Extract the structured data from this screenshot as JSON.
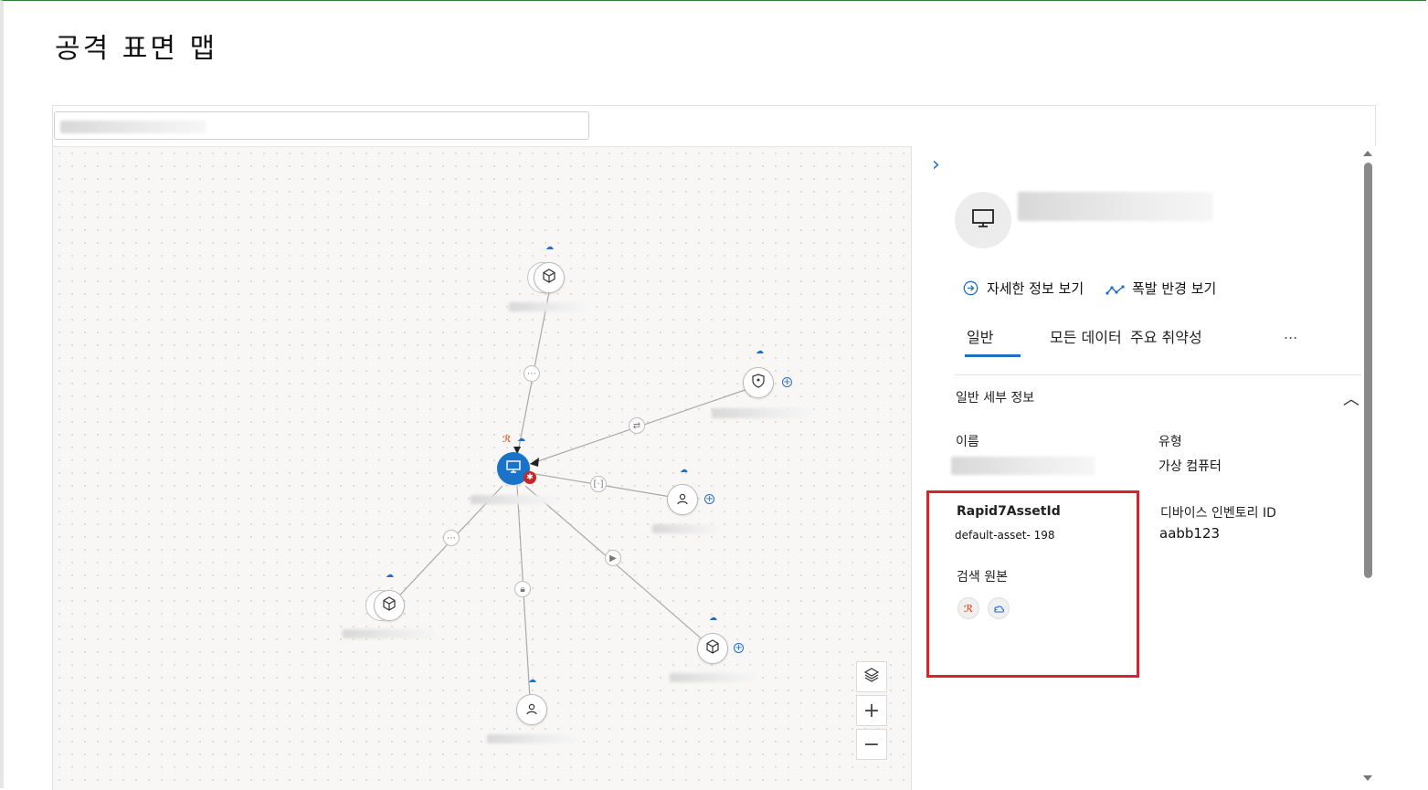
{
  "page": {
    "title": "공격 표면 맵"
  },
  "panel": {
    "actions": {
      "see_more_details": "자세한 정보 보기",
      "view_blast_radius": "폭발 반경 보기"
    },
    "tabs": [
      "일반",
      "모든 데이터",
      "주요 취약성",
      "..."
    ],
    "active_tab": "일반",
    "section": {
      "title": "일반 세부 정보"
    },
    "fields": {
      "name_label": "이름",
      "type_label": "유형",
      "type_value": "가상 컴퓨터",
      "rapid7_label": "Rapid7AssetId",
      "rapid7_value": "default-asset- 198",
      "device_inventory_label": "디바이스 인벤토리 ID",
      "device_inventory_value": "aabb123",
      "discovery_source_label": "검색 원본"
    }
  },
  "map_controls": {
    "layers": "layers-icon",
    "zoom_in": "+",
    "zoom_out": "−"
  },
  "colors": {
    "accent": "#1f6fc6",
    "highlight": "#d9232b",
    "node_main": "#1a73c9",
    "rapid7": "#e8562a"
  }
}
